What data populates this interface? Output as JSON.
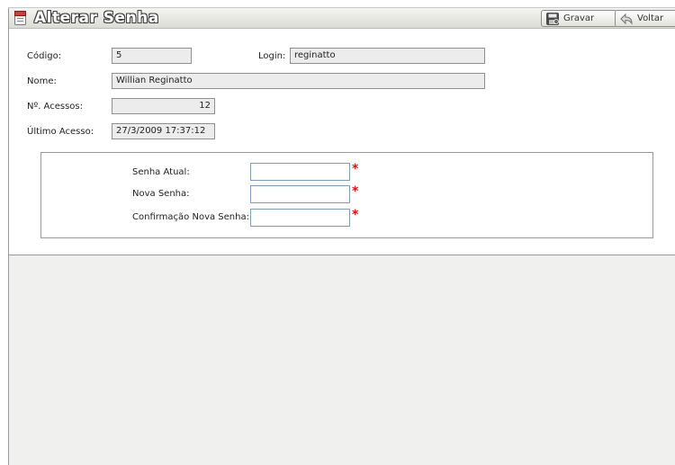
{
  "header": {
    "title": "Alterar Senha",
    "gravar_label": "Gravar",
    "voltar_label": "Voltar"
  },
  "info": {
    "codigo_label": "Código:",
    "codigo_value": "5",
    "login_label": "Login:",
    "login_value": "reginatto",
    "nome_label": "Nome:",
    "nome_value": "Willian Reginatto",
    "acessos_label": "Nº. Acessos:",
    "acessos_value": "12",
    "ultimo_label": "Último Acesso:",
    "ultimo_value": "27/3/2009 17:37:12"
  },
  "password": {
    "atual_label": "Senha Atual:",
    "nova_label": "Nova Senha:",
    "confirm_label": "Confirmação Nova Senha:",
    "required_mark": "*",
    "atual_value": "",
    "nova_value": "",
    "confirm_value": ""
  },
  "colors": {
    "required": "#e01010",
    "title_text": "#ffffff",
    "gray_area": "#f0f0ee"
  }
}
